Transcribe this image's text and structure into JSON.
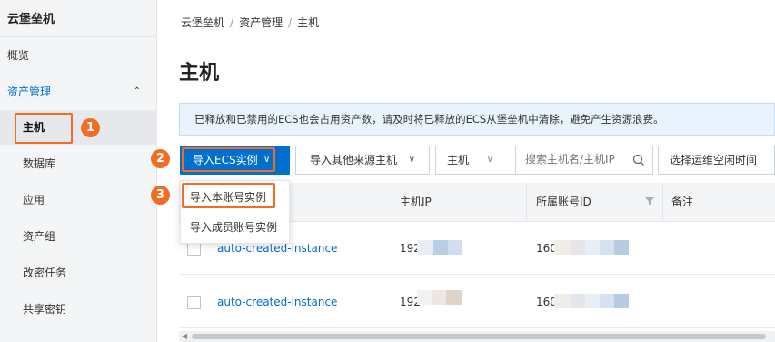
{
  "sidebar": {
    "title": "云堡垒机",
    "overview": "概览",
    "group": "资产管理",
    "group_chevron": "chevron-up-icon",
    "items": [
      {
        "label": "主机",
        "active": true
      },
      {
        "label": "数据库"
      },
      {
        "label": "应用"
      },
      {
        "label": "资产组"
      },
      {
        "label": "改密任务"
      },
      {
        "label": "共享密钥"
      }
    ]
  },
  "breadcrumb": [
    "云堡垒机",
    "资产管理",
    "主机"
  ],
  "page_title": "主机",
  "notice": "已释放和已禁用的ECS也会占用资产数，请及时将已释放的ECS从堡垒机中清除，避免产生资源浪费。",
  "toolbar": {
    "import_ecs": "导入ECS实例",
    "import_other": "导入其他来源主机",
    "host_select": "主机",
    "search_placeholder": "搜索主机名/主机IP",
    "idle_time_select": "选择运维空闲时间"
  },
  "dropdown": {
    "items": [
      "导入本账号实例",
      "导入成员账号实例"
    ]
  },
  "table": {
    "columns": [
      "主机IP",
      "所属账号ID",
      "备注"
    ],
    "rows": [
      {
        "instance": "auto-created-instance",
        "ip": "192",
        "account": "160"
      },
      {
        "instance": "auto-created-instance",
        "ip": "192",
        "account": "160"
      }
    ]
  },
  "steps": [
    "1",
    "2",
    "3"
  ],
  "colors": {
    "accent": "#0070cc",
    "highlight": "#f26c21"
  }
}
